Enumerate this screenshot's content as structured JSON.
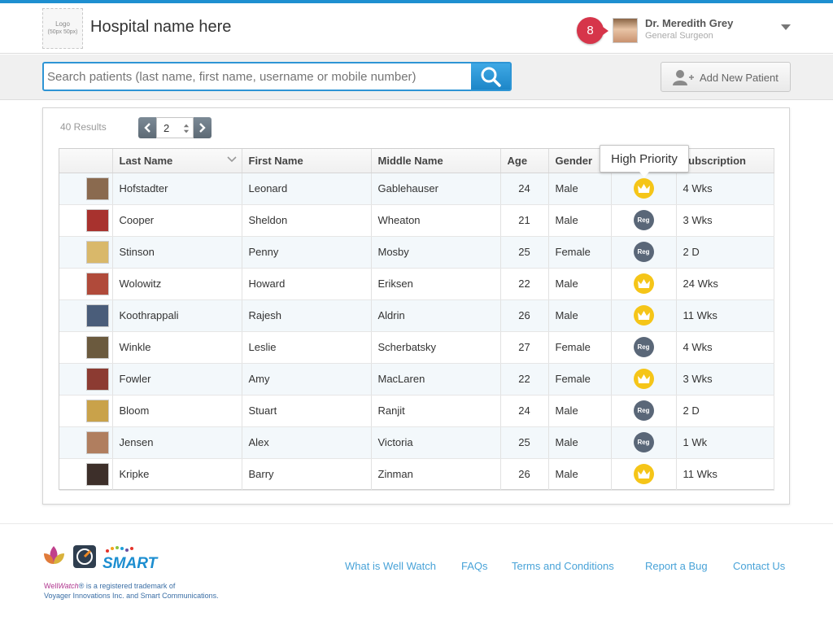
{
  "header": {
    "logo_line1": "Logo",
    "logo_line2": "(50px 50px)",
    "hospital_name": "Hospital name here",
    "notification_count": "8",
    "user_name": "Dr. Meredith Grey",
    "user_role": "General Surgeon"
  },
  "search": {
    "placeholder": "Search patients (last name, first name, username or mobile number)",
    "add_patient_label": "Add New Patient"
  },
  "results": {
    "count_label": "40 Results",
    "page": "2"
  },
  "table": {
    "columns": [
      "Last Name",
      "First Name",
      "Middle Name",
      "Age",
      "Gender",
      "Subscription"
    ],
    "tooltip": "High Priority",
    "reg_label": "Reg",
    "rows": [
      {
        "last": "Hofstadter",
        "first": "Leonard",
        "middle": "Gablehauser",
        "age": "24",
        "gender": "Male",
        "status": "priority",
        "sub": "4 Wks",
        "avatar_color": "#8a6a4f"
      },
      {
        "last": "Cooper",
        "first": "Sheldon",
        "middle": "Wheaton",
        "age": "21",
        "gender": "Male",
        "status": "reg",
        "sub": "3 Wks",
        "avatar_color": "#a8322e"
      },
      {
        "last": "Stinson",
        "first": "Penny",
        "middle": "Mosby",
        "age": "25",
        "gender": "Female",
        "status": "reg",
        "sub": "2 D",
        "avatar_color": "#d9b86a"
      },
      {
        "last": "Wolowitz",
        "first": "Howard",
        "middle": "Eriksen",
        "age": "22",
        "gender": "Male",
        "status": "priority",
        "sub": "24 Wks",
        "avatar_color": "#b04a3a"
      },
      {
        "last": "Koothrappali",
        "first": "Rajesh",
        "middle": "Aldrin",
        "age": "26",
        "gender": "Male",
        "status": "priority",
        "sub": "11 Wks",
        "avatar_color": "#4a5d7a"
      },
      {
        "last": "Winkle",
        "first": "Leslie",
        "middle": "Scherbatsky",
        "age": "27",
        "gender": "Female",
        "status": "reg",
        "sub": "4 Wks",
        "avatar_color": "#6b5a3e"
      },
      {
        "last": "Fowler",
        "first": "Amy",
        "middle": "MacLaren",
        "age": "22",
        "gender": "Female",
        "status": "priority",
        "sub": "3 Wks",
        "avatar_color": "#8c3b32"
      },
      {
        "last": "Bloom",
        "first": "Stuart",
        "middle": "Ranjit",
        "age": "24",
        "gender": "Male",
        "status": "reg",
        "sub": "2 D",
        "avatar_color": "#c9a24a"
      },
      {
        "last": "Jensen",
        "first": "Alex",
        "middle": "Victoria",
        "age": "25",
        "gender": "Male",
        "status": "reg",
        "sub": "1 Wk",
        "avatar_color": "#b07e5f"
      },
      {
        "last": "Kripke",
        "first": "Barry",
        "middle": "Zinman",
        "age": "26",
        "gender": "Male",
        "status": "priority",
        "sub": "11 Wks",
        "avatar_color": "#3d2f2a"
      }
    ]
  },
  "footer": {
    "links": [
      "What is Well Watch",
      "FAQs",
      "Terms and Conditions",
      "Report a Bug",
      "Contact Us"
    ],
    "brand_smart": "SMART",
    "tm_brand_a": "Well",
    "tm_brand_b": "Watch",
    "tm_line1_rest": "® is a registered trademark of",
    "tm_line2": "Voyager Innovations Inc. and Smart Communications."
  },
  "colors": {
    "accent": "#1e8fd0",
    "priority": "#f5c518",
    "reg": "#5a6778",
    "notification": "#d6354a",
    "link": "#49a3d8"
  },
  "icons": {
    "search": "search-icon",
    "add_user": "add-user-icon",
    "priority": "crown-icon",
    "prev": "chevron-left-icon",
    "next": "chevron-right-icon"
  }
}
